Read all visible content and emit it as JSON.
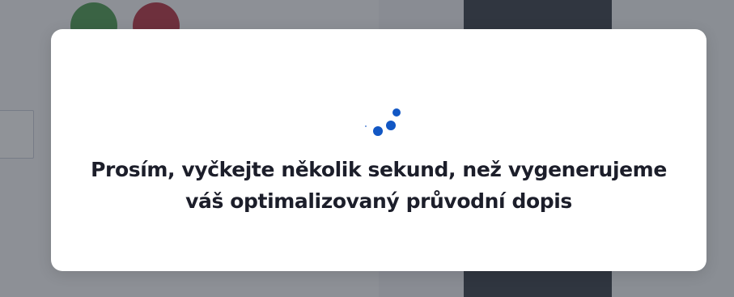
{
  "modal": {
    "message_line1": "Prosím, vyčkejte několik sekund, než vygenerujeme",
    "message_line2": "váš optimalizovaný průvodní dopis",
    "spinner_icon": "loading-spinner-icon",
    "spinner_color": "#1257c4"
  },
  "colors": {
    "overlay": "rgba(35, 39, 48, 0.48)",
    "modal_background": "#ffffff",
    "text": "#1c1e2a",
    "background_green_circle": "#4f9a57",
    "background_red_circle": "#b3394a",
    "background_dark_panel": "#3d4350"
  }
}
